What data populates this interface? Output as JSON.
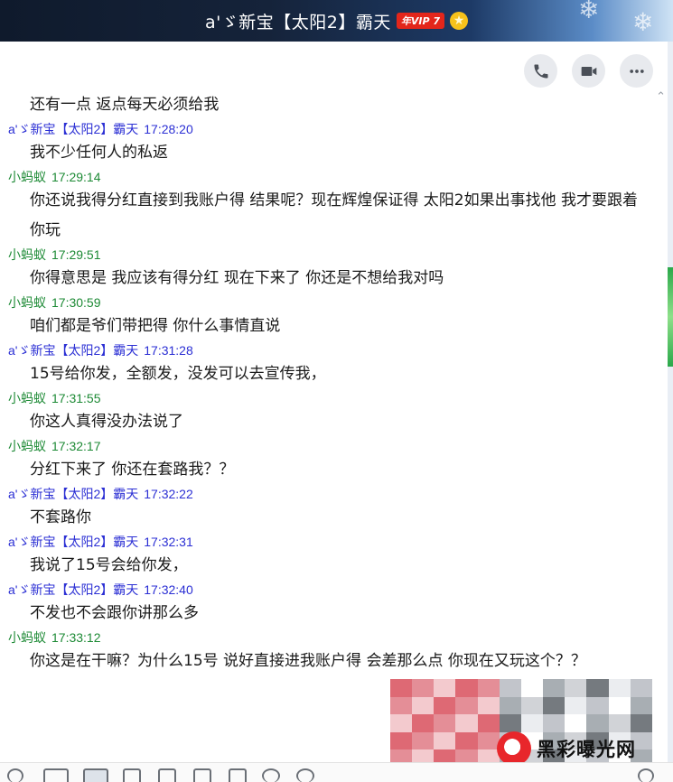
{
  "window": {
    "title": "a'ゞ新宝【太阳2】霸天",
    "vip_badge": "年VIP 7"
  },
  "actions": [
    {
      "name": "voice-call-button",
      "icon": "phone-icon"
    },
    {
      "name": "video-call-button",
      "icon": "video-camera-icon"
    },
    {
      "name": "more-button",
      "icon": "more-dots-icon"
    }
  ],
  "messages": [
    {
      "sender": "",
      "time": "",
      "side": "",
      "text": "还有一点  返点每天必须给我"
    },
    {
      "sender": "a'ゞ新宝【太阳2】霸天",
      "time": "17:28:20",
      "side": "blue",
      "text": "我不少任何人的私返"
    },
    {
      "sender": "小蚂蚁",
      "time": "17:29:14",
      "side": "green",
      "text": "你还说我得分红直接到我账户得 结果呢？现在辉煌保证得 太阳2如果出事找他 我才要跟着你玩"
    },
    {
      "sender": "小蚂蚁",
      "time": "17:29:51",
      "side": "green",
      "text": "你得意思是 我应该有得分红 现在下来了 你还是不想给我对吗"
    },
    {
      "sender": "小蚂蚁",
      "time": "17:30:59",
      "side": "green",
      "text": "咱们都是爷们带把得 你什么事情直说"
    },
    {
      "sender": "a'ゞ新宝【太阳2】霸天",
      "time": "17:31:28",
      "side": "blue",
      "text": "15号给你发，全额发，没发可以去宣传我，"
    },
    {
      "sender": "小蚂蚁",
      "time": "17:31:55",
      "side": "green",
      "text": "你这人真得没办法说了"
    },
    {
      "sender": "小蚂蚁",
      "time": "17:32:17",
      "side": "green",
      "text": "分红下来了 你还在套路我？？"
    },
    {
      "sender": "a'ゞ新宝【太阳2】霸天",
      "time": "17:32:22",
      "side": "blue",
      "text": "不套路你"
    },
    {
      "sender": "a'ゞ新宝【太阳2】霸天",
      "time": "17:32:31",
      "side": "blue",
      "text": "我说了15号会给你发，"
    },
    {
      "sender": "a'ゞ新宝【太阳2】霸天",
      "time": "17:32:40",
      "side": "blue",
      "text": "不发也不会跟你讲那么多"
    },
    {
      "sender": "小蚂蚁",
      "time": "17:33:12",
      "side": "green",
      "text": "你这是在干嘛？为什么15号 说好直接进我账户得 会差那么点  你现在又玩这个？？"
    }
  ],
  "watermark": {
    "text": "黑彩曝光网"
  },
  "colors": {
    "sender_blue": "#2b2fd4",
    "sender_green": "#1d8a35",
    "vip_red": "#e3261b"
  }
}
